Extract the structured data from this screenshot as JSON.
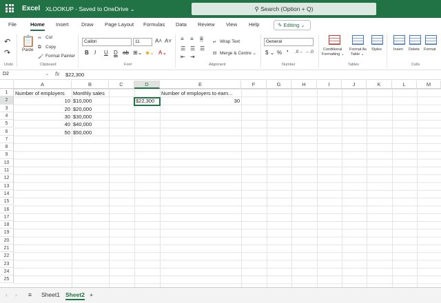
{
  "titlebar": {
    "app": "Excel",
    "doc": "XLOOKUP - Saved to OneDrive ⌄",
    "search": "⚲ Search (Option + Q)"
  },
  "menu": [
    "File",
    "Home",
    "Insert",
    "Draw",
    "Page Layout",
    "Formulas",
    "Data",
    "Review",
    "View",
    "Help"
  ],
  "editing": "✎ Editing ⌄",
  "ribbon": {
    "undo_label": "Undo",
    "paste": "Paste",
    "cut": "Cut",
    "copy": "Copy",
    "format_painter": "Format Painter",
    "clipboard_label": "Clipboard",
    "font_name": "Calibri",
    "font_size": "11",
    "font_label": "Font",
    "wrap_text": "Wrap Text",
    "merge_centre": "Merge & Centre ⌄",
    "alignment_label": "Alignment",
    "number_format": "General",
    "number_label": "Number",
    "cond_format_1": "Conditional",
    "cond_format_2": "Formatting ⌄",
    "format_table_1": "Format As",
    "format_table_2": "Table ⌄",
    "styles": "Styles",
    "tables_label": "Tables",
    "insert": "Insert",
    "delete": "Delete",
    "format": "Format",
    "cells_label": "Cells"
  },
  "formula_bar": {
    "name_box": "D2",
    "fx": "fx",
    "value": "$22,300"
  },
  "columns": [
    "A",
    "B",
    "C",
    "D",
    "E",
    "F",
    "G",
    "H",
    "I",
    "J",
    "K",
    "L",
    "M"
  ],
  "rows": [
    "1",
    "2",
    "3",
    "4",
    "5",
    "6",
    "7",
    "8",
    "9",
    "10",
    "11",
    "12",
    "13",
    "14",
    "15",
    "16",
    "17",
    "18",
    "19",
    "20",
    "21",
    "22",
    "23",
    "24",
    "25"
  ],
  "cells": {
    "A1": "Number of employers",
    "B1": "Monthly sales",
    "E1": "Number of employers to earn...",
    "A2": "10",
    "B2": "$10,000",
    "D2": "$22,300",
    "E2": "30",
    "A3": "20",
    "B3": "$20,000",
    "A4": "30",
    "B4": "$30,000",
    "A5": "40",
    "B5": "$40,000",
    "A6": "50",
    "B6": "$50,000"
  },
  "sheets": [
    "Sheet1",
    "Sheet2"
  ],
  "sheet_add": "+",
  "sheet_menu": "≡"
}
